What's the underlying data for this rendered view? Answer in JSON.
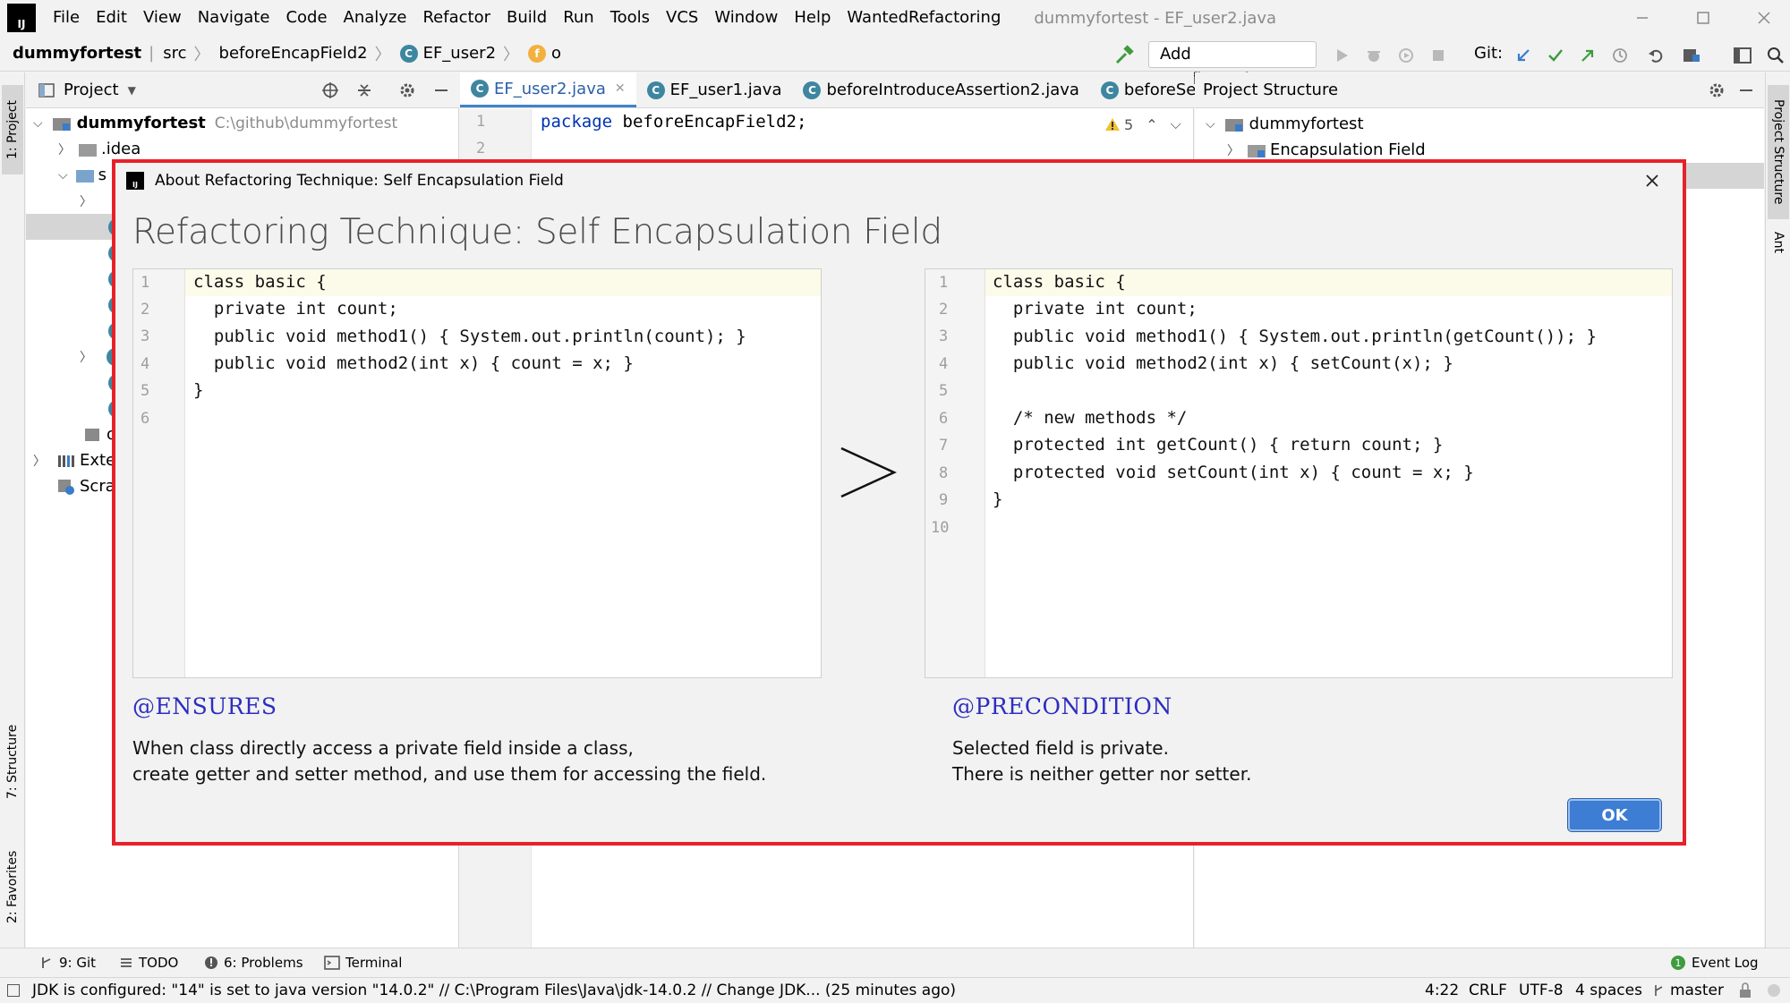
{
  "menu": {
    "items": [
      "File",
      "Edit",
      "View",
      "Navigate",
      "Code",
      "Analyze",
      "Refactor",
      "Build",
      "Run",
      "Tools",
      "VCS",
      "Window",
      "Help",
      "WantedRefactoring"
    ],
    "window_title": "dummyfortest - EF_user2.java"
  },
  "nav": {
    "project": "dummyfortest",
    "src": "src",
    "package": "beforeEncapField2",
    "class": "EF_user2",
    "field": "o",
    "add_configuration": "Add Configuration...",
    "git_label": "Git:"
  },
  "project_panel": {
    "title": "Project",
    "root_name": "dummyfortest",
    "root_path": "C:\\github\\dummyfortest",
    "idea": ".idea",
    "s": "s",
    "o": "o",
    "external": "Exter",
    "scratches": "Scrat"
  },
  "editor": {
    "tabs": [
      "EF_user2.java",
      "EF_user1.java",
      "beforeIntroduceAssertion2.java",
      "beforeSel"
    ],
    "line1_keyword": "package",
    "line1_rest": " beforeEncapField2;",
    "warning_count": "5",
    "lines": [
      "1",
      "2"
    ]
  },
  "project_structure": {
    "title": "Project Structure",
    "root": "dummyfortest",
    "child": "Encapsulation Field"
  },
  "stripes": {
    "project": "1: Project",
    "structure": "7: Structure",
    "favorites": "2: Favorites",
    "right_structure": "Project Structure",
    "ant": "Ant"
  },
  "dialog": {
    "title": "About Refactoring Technique: Self Encapsulation Field",
    "heading": "Refactoring Technique: Self Encapsulation Field",
    "before_code": [
      "class basic {",
      "  private int count;",
      "  public void method1() { System.out.println(count); }",
      "  public void method2(int x) { count = x; }",
      "}",
      ""
    ],
    "after_code": [
      "class basic {",
      "  private int count;",
      "  public void method1() { System.out.println(getCount()); }",
      "  public void method2(int x) { setCount(x); }",
      "",
      "  /* new methods */",
      "  protected int getCount() { return count; }",
      "  protected void setCount(int x) { count = x; }",
      "}",
      ""
    ],
    "before_line_numbers": [
      "1",
      "2",
      "3",
      "4",
      "5",
      "6"
    ],
    "after_line_numbers": [
      "1",
      "2",
      "3",
      "4",
      "5",
      "6",
      "7",
      "8",
      "9",
      "10"
    ],
    "arrow": ">",
    "ensures_label": "@ENSURES",
    "ensures_text_1": "When class directly access a private field inside a class,",
    "ensures_text_2": "create getter and setter method, and use them for accessing the field.",
    "precondition_label": "@PRECONDITION",
    "precondition_text_1": "Selected field is private.",
    "precondition_text_2": "There is neither getter nor setter.",
    "ok": "OK"
  },
  "toolwindows": {
    "git": "9: Git",
    "todo": "TODO",
    "problems": "6: Problems",
    "terminal": "Terminal",
    "event_log": "Event Log"
  },
  "status": {
    "message": "JDK is configured: \"14\" is set to java version \"14.0.2\" // C:\\Program Files\\Java\\jdk-14.0.2 // Change JDK... (25 minutes ago)",
    "position": "4:22",
    "line_sep": "CRLF",
    "encoding": "UTF-8",
    "indent": "4 spaces",
    "branch": "master"
  },
  "colors": {
    "dialog_border": "#e8202a",
    "tag_color": "#2d2dc0",
    "ok_button": "#3d7dd3",
    "keyword": "#0033b3"
  }
}
